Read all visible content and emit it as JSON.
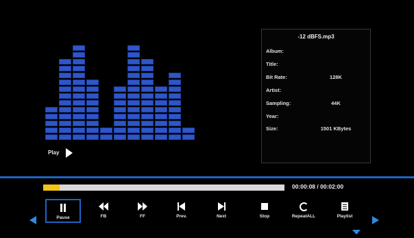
{
  "file": {
    "name": "-12 dBFS.mp3",
    "rows": [
      {
        "label": "Album:",
        "value": ""
      },
      {
        "label": "Title:",
        "value": ""
      },
      {
        "label": "Bit Rate:",
        "value": "128K"
      },
      {
        "label": "Artist:",
        "value": ""
      },
      {
        "label": "Sampling:",
        "value": "44K"
      },
      {
        "label": "Year:",
        "value": ""
      },
      {
        "label": "Size:",
        "value": "1501 KBytes"
      }
    ]
  },
  "status": {
    "label": "Play",
    "icon": "play-icon"
  },
  "spectrum": {
    "color": "#2f56c8",
    "levels": [
      5,
      12,
      14,
      9,
      2,
      8,
      14,
      12,
      8,
      10,
      2
    ]
  },
  "progress": {
    "fraction": 0.068,
    "fill_color": "#f0c419",
    "time": "00:00:08 / 00:02:00"
  },
  "controls": [
    {
      "label": "Pause",
      "icon": "pause-icon",
      "selected": true
    },
    {
      "label": "FB",
      "icon": "fast-backward-icon"
    },
    {
      "label": "FF",
      "icon": "fast-forward-icon"
    },
    {
      "label": "Prev.",
      "icon": "previous-icon"
    },
    {
      "label": "Next",
      "icon": "next-icon"
    },
    {
      "label": "Stop",
      "icon": "stop-icon"
    },
    {
      "label": "RepeatALL",
      "icon": "repeat-icon"
    },
    {
      "label": "Playlist",
      "icon": "playlist-icon"
    }
  ],
  "colors": {
    "accent": "#1f63c5",
    "nav_arrow": "#2d8be0"
  }
}
